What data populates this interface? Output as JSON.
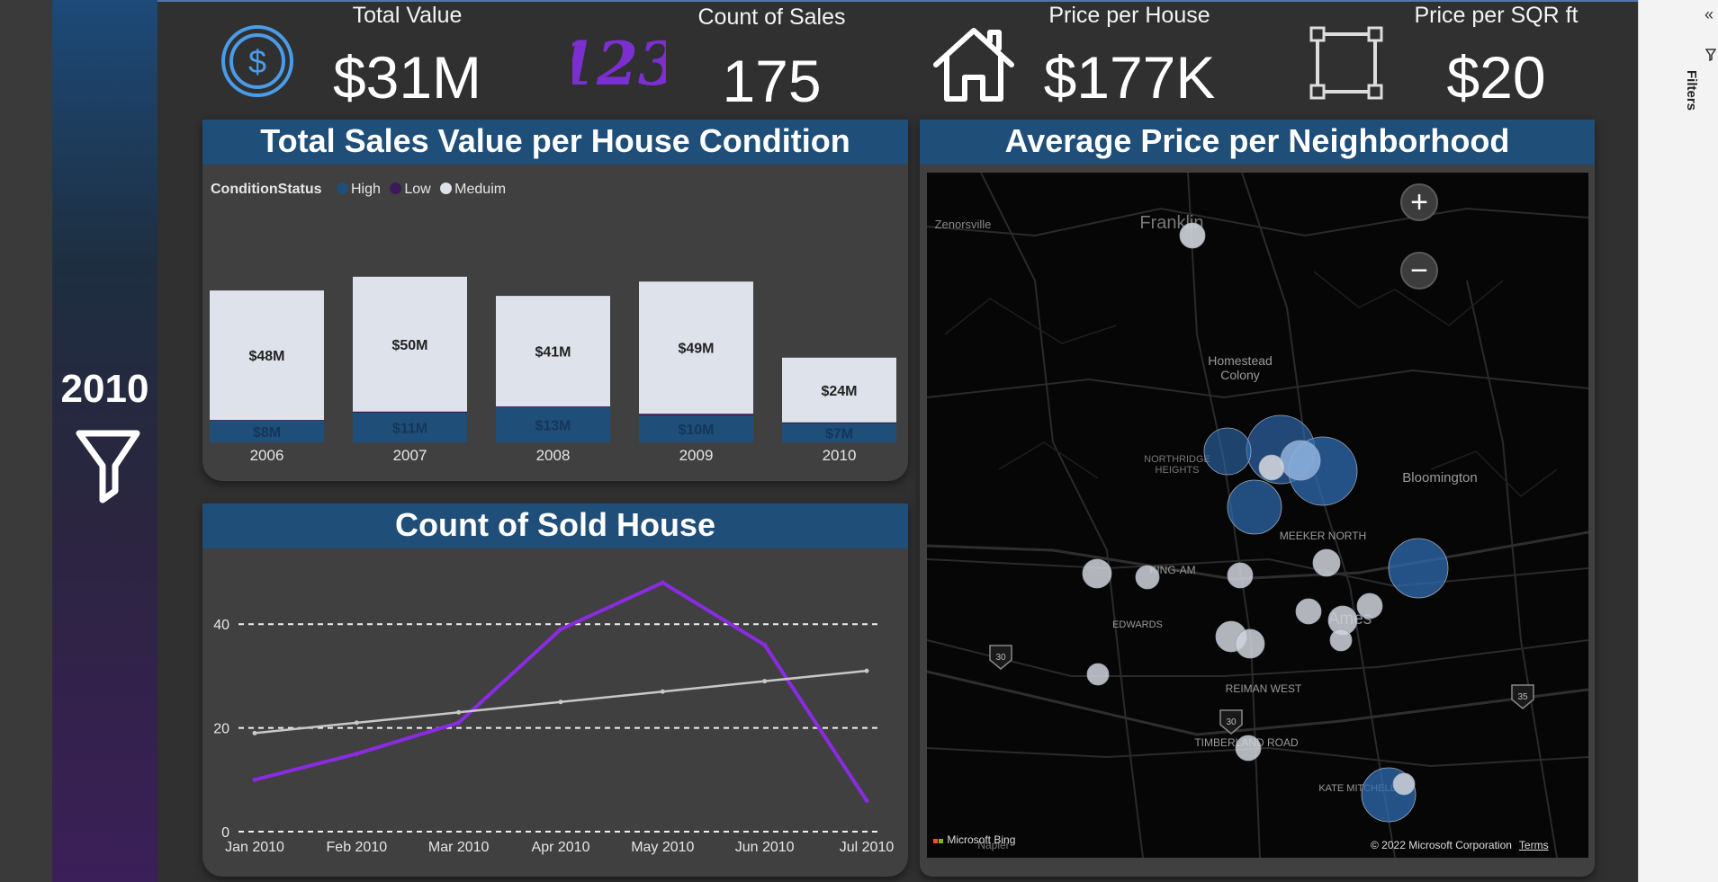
{
  "slicer": {
    "year": "2010"
  },
  "pane": {
    "filters_label": "Filters",
    "collapse_glyph": "«"
  },
  "kpis": [
    {
      "title": "Total Value",
      "value": "$31M",
      "icon": "dollar-circle-icon"
    },
    {
      "title": "Count of Sales",
      "value": "175",
      "icon": "number-123-icon"
    },
    {
      "title": "Price per House",
      "value": "$177K",
      "icon": "house-icon"
    },
    {
      "title": "Price per SQR ft",
      "value": "$20",
      "icon": "square-area-icon"
    }
  ],
  "colors": {
    "high": "#1f4e79",
    "low": "#3b1a5a",
    "medium": "#dee2ea",
    "line_count": "#8a2be2",
    "line_trend": "#c8c8c8",
    "accent": "#1f4e79"
  },
  "bar_chart": {
    "title": "Total Sales Value per House Condition",
    "legend_title": "ConditionStatus",
    "legend_items": [
      "High",
      "Low",
      "Meduim"
    ]
  },
  "line_chart": {
    "title": "Count of Sold House"
  },
  "map": {
    "title": "Average Price per Neighborhood",
    "zoom_in": "+",
    "zoom_out": "−",
    "places": [
      "Zenorsville",
      "Franklin",
      "Homestead",
      "Colony",
      "Bloomington",
      "NORTHRIDGE",
      "HEIGHTS",
      "MEEKER NORTH",
      "KING-AM",
      "EDWARDS",
      "Ames",
      "REIMAN WEST",
      "TIMBERLAND ROAD",
      "KATE MITCHELL",
      "Napier"
    ],
    "highways": [
      "30",
      "30",
      "35"
    ],
    "attribution_bing": "Microsoft Bing",
    "attribution_copyright": "© 2022 Microsoft Corporation",
    "attribution_terms": "Terms"
  },
  "chart_data": [
    {
      "type": "bar",
      "title": "Total Sales Value per House Condition",
      "categories": [
        "2006",
        "2007",
        "2008",
        "2009",
        "2010"
      ],
      "series": [
        {
          "name": "High",
          "values": [
            8,
            11,
            13,
            10,
            7
          ],
          "labels": [
            "$8M",
            "$11M",
            "$13M",
            "$10M",
            "$7M"
          ]
        },
        {
          "name": "Low",
          "values": [
            0.3,
            0.4,
            0.3,
            0.6,
            0.4
          ],
          "labels": [
            "",
            "",
            "",
            "",
            ""
          ]
        },
        {
          "name": "Meduim",
          "values": [
            48,
            50,
            41,
            49,
            24
          ],
          "labels": [
            "$48M",
            "$50M",
            "$41M",
            "$49M",
            "$24M"
          ]
        }
      ],
      "stacked": true,
      "legend": "top-left"
    },
    {
      "type": "line",
      "title": "Count of Sold House",
      "categories": [
        "Jan 2010",
        "Feb 2010",
        "Mar 2010",
        "Apr 2010",
        "May 2010",
        "Jun 2010",
        "Jul 2010"
      ],
      "series": [
        {
          "values": [
            10,
            15,
            21,
            39,
            48,
            36,
            6
          ]
        },
        {
          "values": [
            19,
            21,
            23,
            25,
            27,
            29,
            31
          ]
        }
      ],
      "yticks": [
        0,
        20,
        40
      ],
      "ylim": [
        0,
        50
      ],
      "grid": true
    }
  ]
}
